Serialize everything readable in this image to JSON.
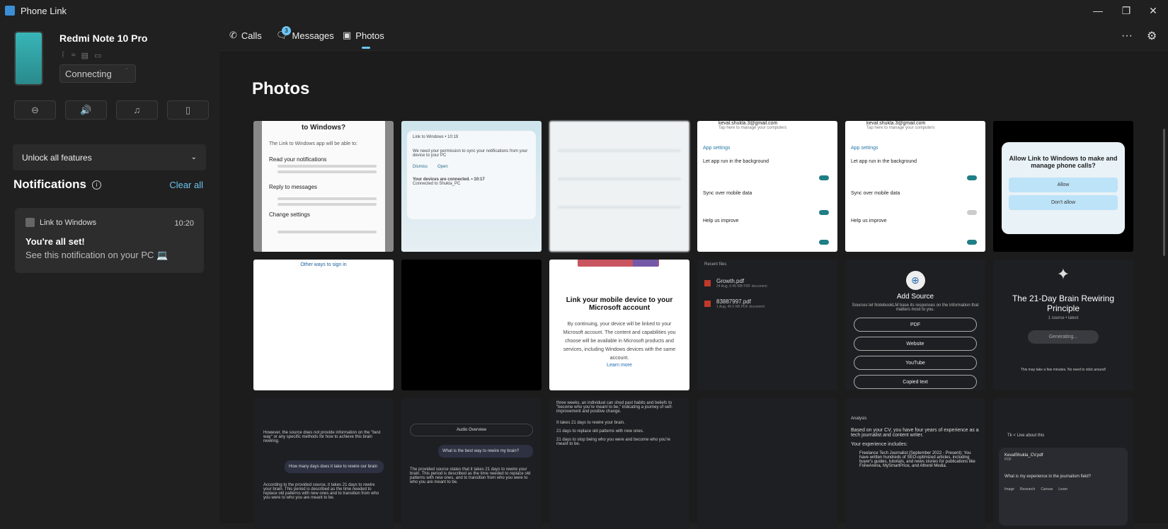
{
  "app": {
    "title": "Phone Link"
  },
  "device": {
    "name": "Redmi Note 10 Pro",
    "status": "Connecting"
  },
  "sidebar": {
    "unlock_label": "Unlock all features",
    "notifications_title": "Notifications",
    "clear_all": "Clear all",
    "notification": {
      "app": "Link to Windows",
      "time": "10:20",
      "title": "You're all set!",
      "body": "See this notification on your PC 💻"
    }
  },
  "tabs": [
    {
      "label": "Calls"
    },
    {
      "label": "Messages",
      "badge": "3"
    },
    {
      "label": "Photos",
      "active": true
    }
  ],
  "main": {
    "title": "Photos"
  },
  "tiles": {
    "t1": {
      "title": "to Windows?",
      "intro": "The Link to Windows app will be able to:",
      "items": [
        "Read your notifications",
        "Reply to messages",
        "Change settings"
      ]
    },
    "t2": {
      "app": "Link to Windows • 10:19",
      "body": "We need your permission to sync your notifications from your device to your PC",
      "dismiss": "Dismiss",
      "open": "Open",
      "connected": "Your devices are connected. • 10:17",
      "connected_sub": "Connected to Shukla_PC"
    },
    "t4": {
      "email": "keval.shukla.3@gmail.com",
      "sub": "Tap here to manage your computers",
      "section": "App settings",
      "s1": "Let app run in the background",
      "s2": "Sync over mobile data",
      "s3": "Help us improve"
    },
    "t6": {
      "title": "Allow Link to Windows to make and manage phone calls?",
      "allow": "Allow",
      "deny": "Don't allow"
    },
    "t7": {
      "link": "Other ways to sign in"
    },
    "t9": {
      "title": "Link your mobile device to your Microsoft account",
      "body": "By continuing, your device will be linked to your Microsoft account. The content and capabilities you choose will be available in Microsoft products and services, including Windows devices with the same account.",
      "learn": "Learn more"
    },
    "t10": {
      "header": "Recent files",
      "f1": "Growth.pdf",
      "f1_meta": "24 Aug, 0.45 MB PDF document",
      "f2": "83887997.pdf",
      "f2_meta": "1 Aug, 40.0 KB PDF document"
    },
    "t11": {
      "title": "Add Source",
      "sub": "Sources let NotebookLM base its responses on the information that matters most to you.",
      "options": [
        "PDF",
        "Website",
        "YouTube",
        "Copied text"
      ]
    },
    "t12": {
      "title": "The 21-Day Brain Rewiring Principle",
      "meta": "1 source • latest",
      "btn": "Generating...",
      "foot": "This may take a few minutes. No need to stick around!"
    },
    "t13": {
      "q": "How many days does it take to rewire our brain",
      "a": "According to the provided source, it takes 21 days to rewire your brain. This period is described as the time needed to replace old patterns with new ones and to transition from who you were to who you are meant to be.",
      "b": "However, the source does not provide information on the \"best way\" or any specific methods for how to achieve this brain rewiring."
    },
    "t14": {
      "audio": "Audio Overview",
      "q": "What is the best way to rewire my brain?",
      "a": "The provided source states that it takes 21 days to rewire your brain. This period is described as the time needed to replace old patterns with new ones, and to transition from who you were to who you are meant to be."
    },
    "t15": {
      "a": "three weeks, an individual can shed past habits and beliefs to \"become who you're meant to be,\" indicating a journey of self-improvement and positive change.",
      "l1": "It takes 21 days to rewire your brain.",
      "l2": "21 days to replace old patterns with new ones.",
      "l3": "21 days to stop being who you were and become who you're meant to be."
    },
    "t17": {
      "label": "Analysis",
      "a": "Based on your CV, you have four years of experience as a tech journalist and content writer.",
      "b": "Your experience includes:",
      "c": "Freelance Tech Journalist (September 2022 - Present): You have written hundreds of SEO-optimized articles, including buyer's guides, tutorials, and news stories for publications like FoneArena, MySmartPrice, and Athenil Media."
    },
    "t18": {
      "live": "Tk < Live about this",
      "file": "KevalShukla_CV.pdf",
      "type": "PDF",
      "q": "What is my experience in the journalism field?",
      "chips": [
        "Image",
        "Research",
        "Canvas",
        "Learn"
      ]
    }
  },
  "colors": {
    "accent": "#6cc4f0",
    "background": "#202020",
    "card": "#2d2d2d"
  }
}
